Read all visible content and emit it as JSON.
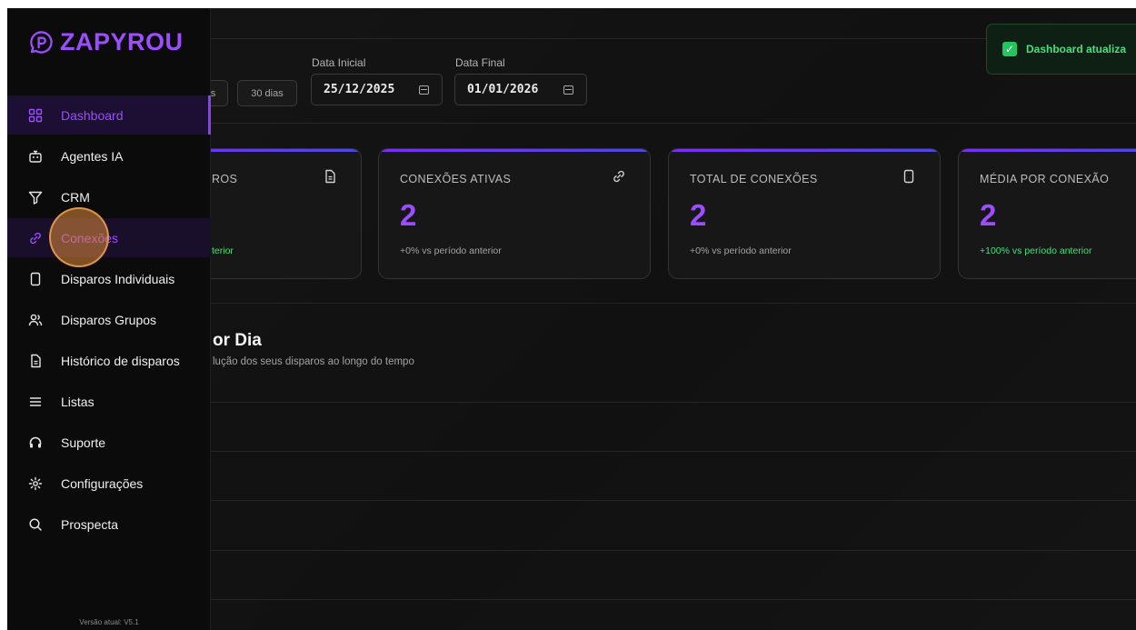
{
  "brand": {
    "name": "ZAPYROU",
    "color": "#9b4dff"
  },
  "sidebar": {
    "items": [
      {
        "label": "Dashboard",
        "icon": "grid-icon",
        "state": "active"
      },
      {
        "label": "Agentes IA",
        "icon": "robot-icon"
      },
      {
        "label": "CRM",
        "icon": "filter-icon"
      },
      {
        "label": "Conexões",
        "icon": "link-icon",
        "state": "hover"
      },
      {
        "label": "Disparos Individuais",
        "icon": "phone-icon"
      },
      {
        "label": "Disparos Grupos",
        "icon": "users-icon"
      },
      {
        "label": "Histórico de disparos",
        "icon": "file-icon"
      },
      {
        "label": "Listas",
        "icon": "list-icon"
      },
      {
        "label": "Suporte",
        "icon": "headset-icon"
      },
      {
        "label": "Configurações",
        "icon": "gear-icon"
      },
      {
        "label": "Prospecta",
        "icon": "search-icon"
      }
    ],
    "version": "Versão atual: V5.1"
  },
  "filters": {
    "chip_partial": "s",
    "chip_30": "30 dias",
    "start_label": "Data Inicial",
    "start_value": "25/12/2025",
    "end_label": "Data Final",
    "end_value": "01/01/2026"
  },
  "toast": {
    "text": "Dashboard atualiza"
  },
  "cards": [
    {
      "title": "ROS",
      "value": "",
      "delta": "terior",
      "delta_color": "#4ade80",
      "icon": "file-icon"
    },
    {
      "title": "CONEXÕES ATIVAS",
      "value": "2",
      "delta": "+0% vs período anterior",
      "delta_color": "#a3a3a3",
      "icon": "link-icon"
    },
    {
      "title": "TOTAL DE CONEXÕES",
      "value": "2",
      "delta": "+0% vs período anterior",
      "delta_color": "#a3a3a3",
      "icon": "phone-icon"
    },
    {
      "title": "MÉDIA POR CONEXÃO",
      "value": "2",
      "delta": "+100% vs período anterior",
      "delta_color": "#4ade80",
      "icon": ""
    }
  ],
  "chart": {
    "title": "or Dia",
    "subtitle": "lução dos seus disparos ao longo do tempo"
  }
}
